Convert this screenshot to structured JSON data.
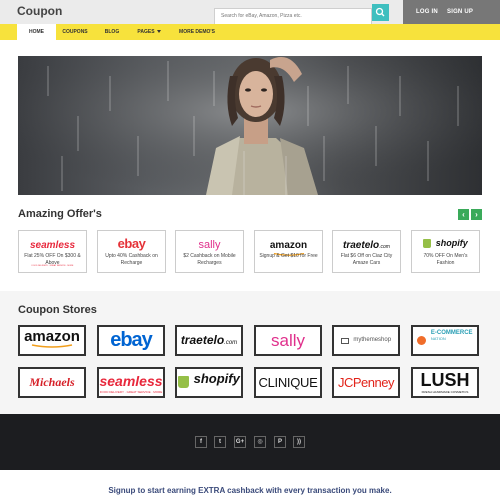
{
  "header": {
    "brand": "Coupon",
    "search_placeholder": "Search for eBay, Amazon, Pizza etc.",
    "login": "LOG IN",
    "signup": "SIGN UP"
  },
  "nav": [
    {
      "label": "HOME"
    },
    {
      "label": "COUPONS"
    },
    {
      "label": "BLOG"
    },
    {
      "label": "PAGES"
    },
    {
      "label": "MORE DEMO'S"
    }
  ],
  "offers": {
    "title": "Amazing Offer's",
    "prev_icon": "‹",
    "next_icon": "›",
    "items": [
      {
        "brand": "seamless",
        "sub": "FOOD DELIVERY · GREAT SERVICE · MORE",
        "text": "Flat 25% OFF On $300 & Above"
      },
      {
        "brand": "ebay",
        "text": "Upto 40% Cashback on Recharge"
      },
      {
        "brand": "sally",
        "text": "$2 Cashback on Mobile Recharges"
      },
      {
        "brand": "amazon",
        "text": "Signup & Get $10 for Free"
      },
      {
        "brand": "traetelo",
        "suffix": ".com",
        "text": "Flat $6 Off on Ciaz City Amaze Cars"
      },
      {
        "brand": "shopify",
        "text": "70% OFF On Men's Fashion"
      }
    ]
  },
  "stores": {
    "title": "Coupon Stores",
    "items": [
      {
        "brand": "amazon"
      },
      {
        "brand": "ebay"
      },
      {
        "brand": "traetelo",
        "suffix": ".com"
      },
      {
        "brand": "sally"
      },
      {
        "brand": "mythemeshop"
      },
      {
        "brand": "E-COMMERCE",
        "sub": "NATION"
      },
      {
        "brand": "Michaels"
      },
      {
        "brand": "seamless",
        "sub": "FOOD DELIVERY · GREAT SERVICE · MORE"
      },
      {
        "brand": "shopify"
      },
      {
        "brand": "CLINIQUE"
      },
      {
        "brand": "JCPenney"
      },
      {
        "brand": "LUSH",
        "sub": "FRESH HANDMADE COSMETICS"
      }
    ]
  },
  "social": [
    {
      "icon": "facebook-icon",
      "glyph": "f"
    },
    {
      "icon": "twitter-icon",
      "glyph": "t"
    },
    {
      "icon": "google-plus-icon",
      "glyph": "G+"
    },
    {
      "icon": "instagram-icon",
      "glyph": "◎"
    },
    {
      "icon": "pinterest-icon",
      "glyph": "P"
    },
    {
      "icon": "rss-icon",
      "glyph": "))"
    }
  ],
  "cta": "Signup to start earning EXTRA cashback with every transaction you make.",
  "colors": {
    "accent": "#f7e23c",
    "search_button": "#3fbfbf",
    "auth_bg": "#777777",
    "slider_arrow": "#3aaa5a",
    "footer_bg": "#1c1d20",
    "cta_text": "#3a4a7a"
  }
}
